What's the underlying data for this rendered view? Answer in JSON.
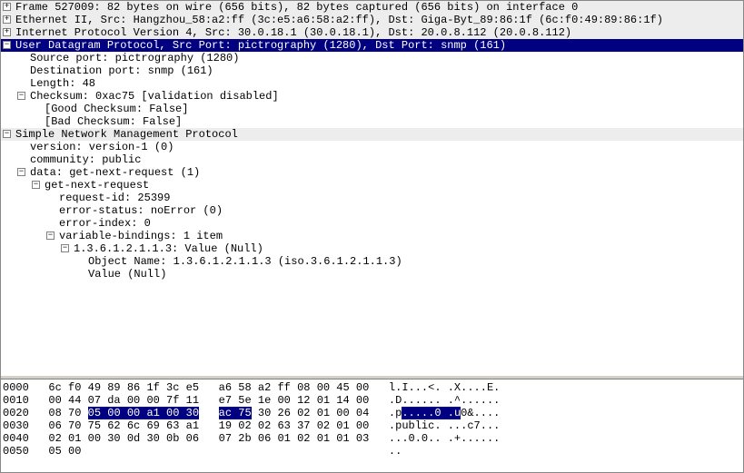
{
  "tree": {
    "r0": "Frame 527009: 82 bytes on wire (656 bits), 82 bytes captured (656 bits) on interface 0",
    "r1": "Ethernet II, Src: Hangzhou_58:a2:ff (3c:e5:a6:58:a2:ff), Dst: Giga-Byt_89:86:1f (6c:f0:49:89:86:1f)",
    "r2": "Internet Protocol Version 4, Src: 30.0.18.1 (30.0.18.1), Dst: 20.0.8.112 (20.0.8.112)",
    "r3": "User Datagram Protocol, Src Port: pictrography (1280), Dst Port: snmp (161)",
    "r4": "Source port: pictrography (1280)",
    "r5": "Destination port: snmp (161)",
    "r6": "Length: 48",
    "r7": "Checksum: 0xac75 [validation disabled]",
    "r8": "[Good Checksum: False]",
    "r9": "[Bad Checksum: False]",
    "r10": "Simple Network Management Protocol",
    "r11": "version: version-1 (0)",
    "r12": "community: public",
    "r13": "data: get-next-request (1)",
    "r14": "get-next-request",
    "r15": "request-id: 25399",
    "r16": "error-status: noError (0)",
    "r17": "error-index: 0",
    "r18": "variable-bindings: 1 item",
    "r19": "1.3.6.1.2.1.1.3: Value (Null)",
    "r20": "Object Name: 1.3.6.1.2.1.1.3 (iso.3.6.1.2.1.1.3)",
    "r21": "Value (Null)"
  },
  "hex": {
    "row0": {
      "off": "0000",
      "b1": "6c f0 49 89 86 1f 3c e5",
      "b2": "a6 58 a2 ff 08 00 45 00",
      "asc": "l.I...<. .X....E."
    },
    "row1": {
      "off": "0010",
      "b1": "00 44 07 da 00 00 7f 11",
      "b2": "e7 5e 1e 00 12 01 14 00",
      "asc": ".D...... .^......"
    },
    "row2": {
      "off": "0020",
      "b1a": "08 70 ",
      "b1h": "05 00 00 a1 00 30",
      "b2h": "ac 75",
      "b2b": " 30 26 02 01 00 04",
      "asca": ".p",
      "asch1": ".....0 .u",
      "ascb": "0&....",
      "asc": ""
    },
    "row3": {
      "off": "0030",
      "b1": "06 70 75 62 6c 69 63 a1",
      "b2": "19 02 02 63 37 02 01 00",
      "asc": ".public. ...c7..."
    },
    "row4": {
      "off": "0040",
      "b1": "02 01 00 30 0d 30 0b 06",
      "b2": "07 2b 06 01 02 01 01 03",
      "asc": "...0.0.. .+......"
    },
    "row5": {
      "off": "0050",
      "b1": "05 00",
      "b2": "",
      "asc": ".."
    }
  }
}
